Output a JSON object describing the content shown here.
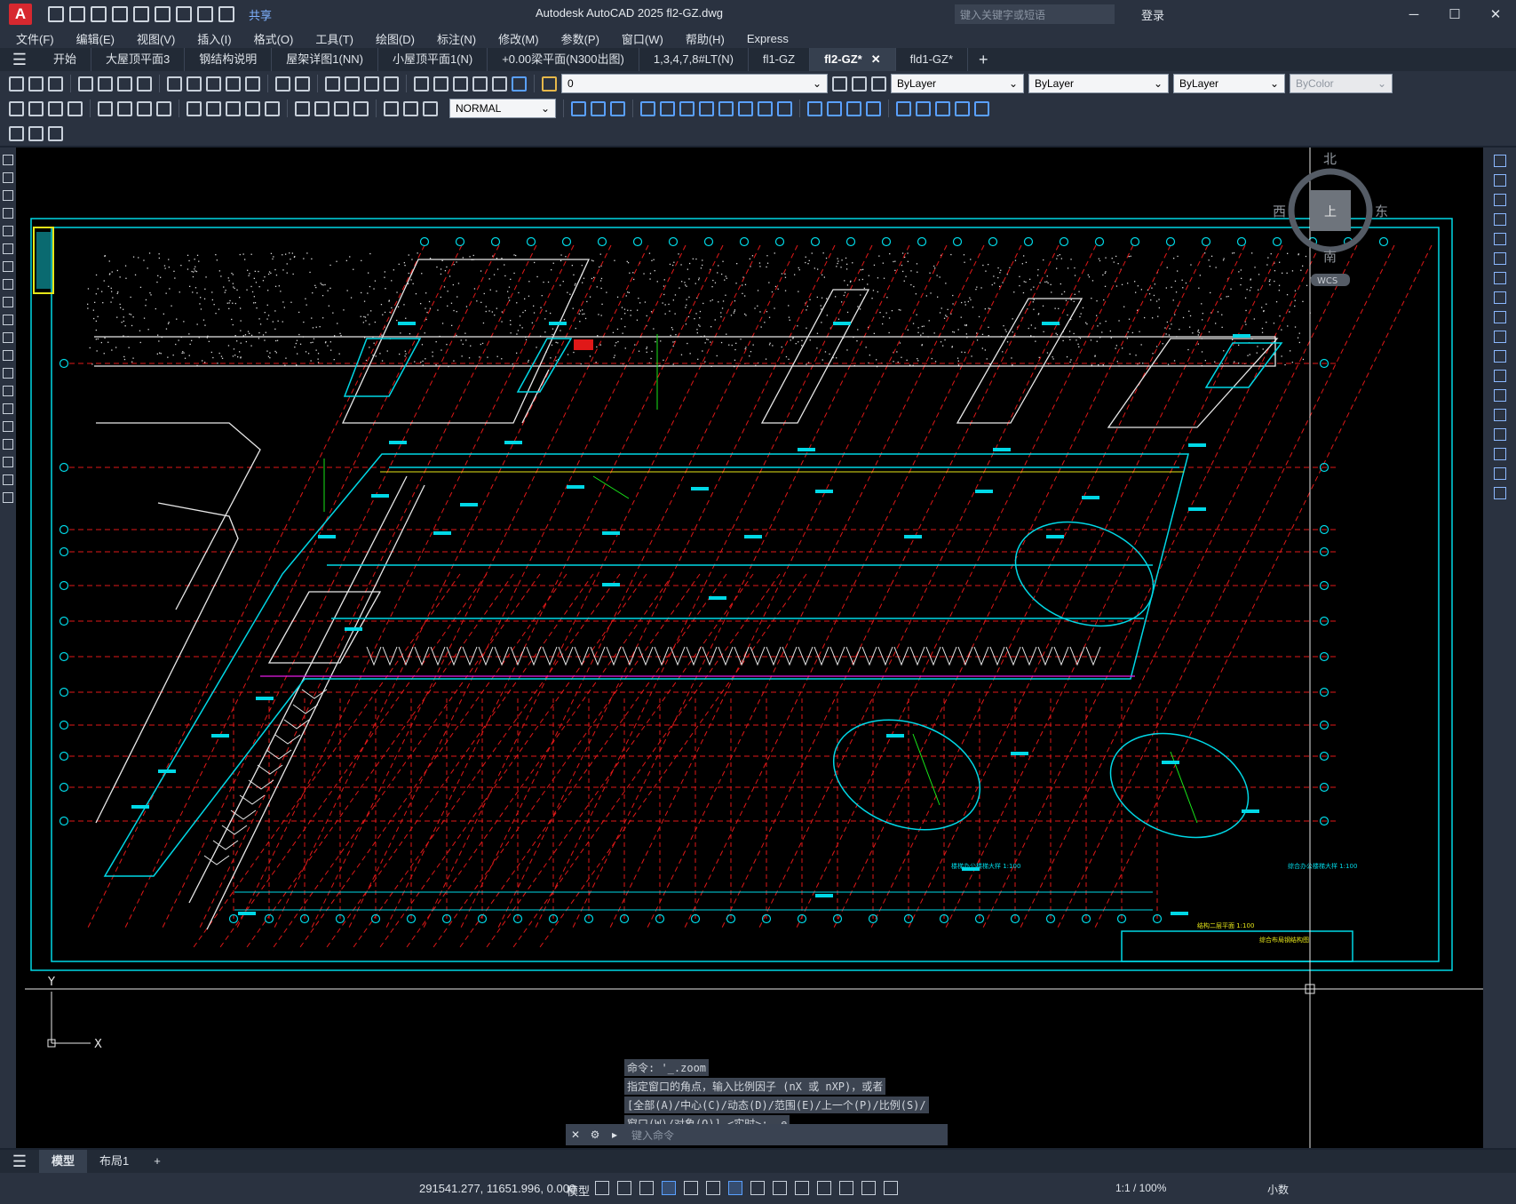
{
  "titlebar": {
    "app_badge": "A",
    "share_label": "共享",
    "title": "Autodesk AutoCAD 2025    fl2-GZ.dwg",
    "search_placeholder": "键入关键字或短语",
    "login_label": "登录",
    "minimize": "─",
    "maximize": "☐",
    "close": "✕"
  },
  "menu": {
    "items": [
      "文件(F)",
      "编辑(E)",
      "视图(V)",
      "插入(I)",
      "格式(O)",
      "工具(T)",
      "绘图(D)",
      "标注(N)",
      "修改(M)",
      "参数(P)",
      "窗口(W)",
      "帮助(H)",
      "Express"
    ]
  },
  "tabs": {
    "items": [
      "开始",
      "大屋顶平面3",
      "钢结构说明",
      "屋架详图1(NN)",
      "小屋顶平面1(N)",
      "+0.00梁平面(N300出图)",
      "1,3,4,7,8#LT(N)",
      "fl1-GZ",
      "fl2-GZ*",
      "fld1-GZ*"
    ],
    "active_index": 8,
    "close_glyph": "✕",
    "add_glyph": "+"
  },
  "toolbar": {
    "layer_value": "0",
    "color_value": "ByLayer",
    "linetype_value": "ByLayer",
    "lineweight_value": "ByLayer",
    "plotstyle_value": "ByColor",
    "dimstyle_value": "NORMAL"
  },
  "viewcube": {
    "north": "北",
    "south": "南",
    "east": "东",
    "west": "西",
    "top": "上",
    "wcs": "WCS"
  },
  "drawing": {
    "ucs_y": "Y",
    "ucs_x": "X",
    "label_ellipse_1": "楼梯办公楼梯大样 1:100",
    "label_ellipse_2": "综合办公楼梯大样 1:100",
    "label_plan": "结构二层平面 1:100",
    "label_titleblock": "综合布局钢结构图"
  },
  "command": {
    "line1": "命令: '_.zoom",
    "line2": "指定窗口的角点，输入比例因子 (nX 或 nXP)，或者",
    "line3": "[全部(A)/中心(C)/动态(D)/范围(E)/上一个(P)/比例(S)/",
    "line4": "窗口(W)/对象(O)] <实时>: _e",
    "input_placeholder": "键入命令"
  },
  "layouts": {
    "items": [
      "模型",
      "布局1"
    ],
    "active_index": 0,
    "add_glyph": "+"
  },
  "status": {
    "coordinates": "291541.277, 11651.996, 0.000",
    "space": "模型",
    "annotation_scale": "1:1 / 100%",
    "units": "小数"
  },
  "colors": {
    "canvas_bg": "#000000",
    "frame_cyan": "#00d8e6",
    "axis_red": "#e01818",
    "white_line": "#e8e8e8",
    "green": "#19e619",
    "yellow": "#e6e619",
    "magenta": "#e619e6"
  }
}
